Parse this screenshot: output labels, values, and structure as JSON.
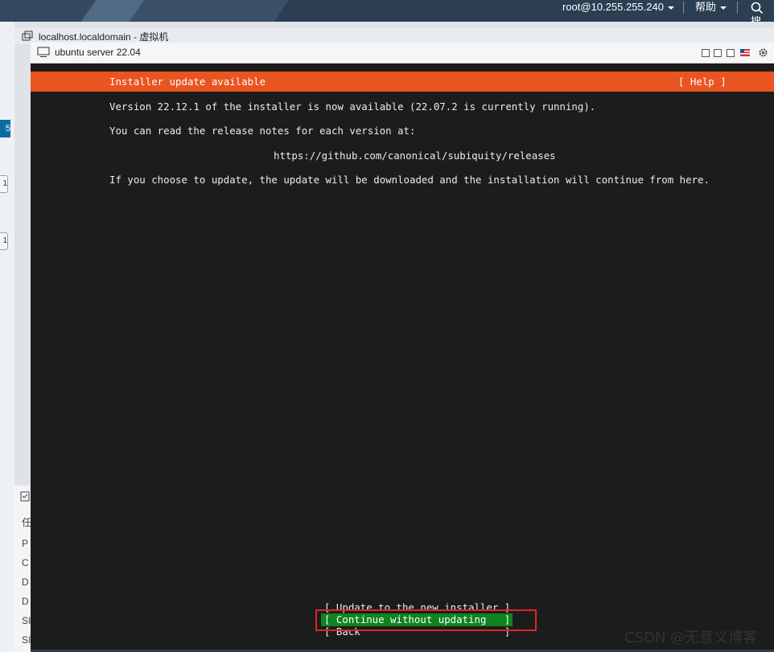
{
  "topbar": {
    "user": "root@10.255.255.240",
    "help": "帮助",
    "search_label": "搜"
  },
  "left_panel": {
    "tab_badge": "5",
    "btn1": "1",
    "btn2": "1",
    "bottom_rows": [
      "任",
      "P",
      "C",
      "D",
      "D",
      "SI",
      "SI"
    ]
  },
  "vm_window": {
    "title": "localhost.localdomain - 虚拟机",
    "console_title": "ubuntu server 22.04"
  },
  "installer": {
    "header_title": "Installer update available",
    "help_button": "[ Help ]",
    "line1": "Version 22.12.1 of the installer is now available (22.07.2 is currently running).",
    "line2": "You can read the release notes for each version at:",
    "url": "https://github.com/canonical/subiquity/releases",
    "line3": "If you choose to update, the update will be downloaded and the installation will continue from here.",
    "options": [
      "[ Update to the new installer ]",
      "[ Continue without updating   ]",
      "[ Back                        ]"
    ]
  },
  "watermark": "CSDN @无意义博客",
  "colors": {
    "ubuntu_orange": "#e95420",
    "selected_green": "#0e8420",
    "highlight_red": "#e0242b",
    "terminal_bg": "#1c1c1c"
  }
}
